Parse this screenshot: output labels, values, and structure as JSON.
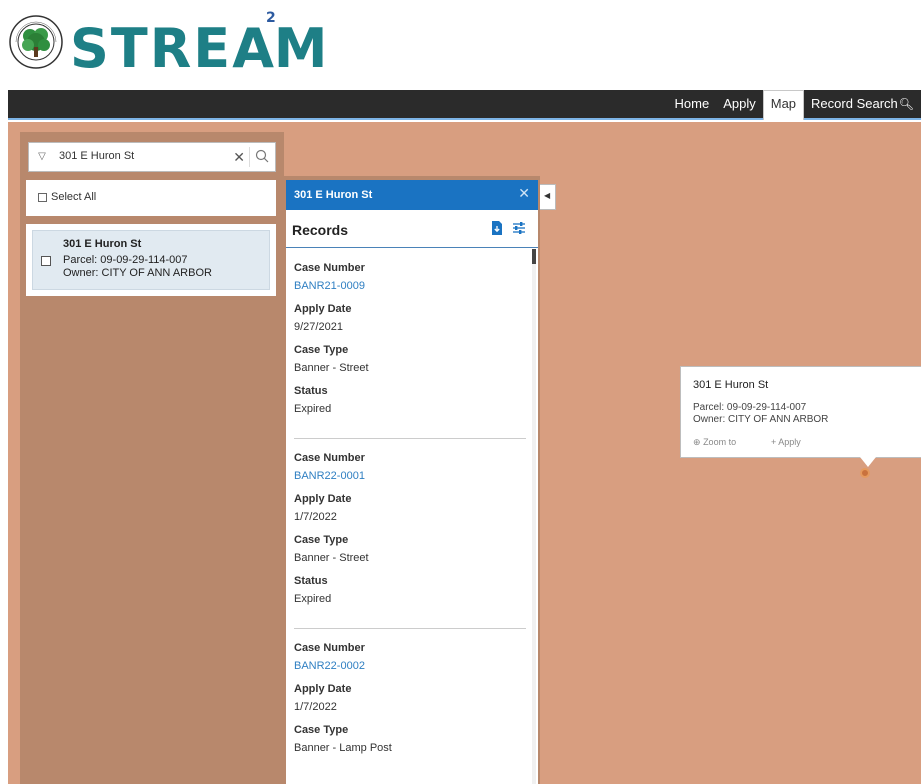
{
  "header": {
    "brand_main": "STREAM",
    "brand_pre": "STREA",
    "brand_sup": "2",
    "brand_post": "M",
    "seal_text": [
      "CITY OF ANN ARBOR",
      "MICHIGAN"
    ]
  },
  "nav": {
    "items": [
      "Home",
      "Apply",
      "Map",
      "Record Search"
    ],
    "active": "Map"
  },
  "search": {
    "value": "301 E Huron St"
  },
  "results": {
    "select_all_label": "Select All",
    "items": [
      {
        "title": "301 E Huron St",
        "parcel": "Parcel: 09-09-29-114-007",
        "owner": "Owner: CITY OF ANN ARBOR"
      }
    ]
  },
  "records_panel": {
    "header_title": "301 E Huron St",
    "sub_title": "Records",
    "labels": {
      "case_number": "Case Number",
      "apply_date": "Apply Date",
      "case_type": "Case Type",
      "status": "Status"
    },
    "records": [
      {
        "case_number": "BANR21-0009",
        "apply_date": "9/27/2021",
        "case_type": "Banner - Street",
        "status": "Expired"
      },
      {
        "case_number": "BANR22-0001",
        "apply_date": "1/7/2022",
        "case_type": "Banner - Street",
        "status": "Expired"
      },
      {
        "case_number": "BANR22-0002",
        "apply_date": "1/7/2022",
        "case_type": "Banner - Lamp Post",
        "status": ""
      }
    ]
  },
  "popup": {
    "title": "301 E Huron St",
    "parcel": "Parcel: 09-09-29-114-007",
    "owner": "Owner: CITY OF ANN ARBOR",
    "zoom_label": "Zoom to",
    "apply_label": "Apply"
  },
  "colors": {
    "brand_teal": "#1e7f86",
    "nav_bg": "#2b2b2b",
    "map_bg": "#d89e80",
    "panel_bg": "#b8886c",
    "records_header": "#1a73c2",
    "link": "#2f7fc2"
  },
  "icons": {
    "search": "search-icon",
    "clear": "close-icon",
    "dropdown": "triangle-down-icon",
    "export": "document-download-icon",
    "filter": "sliders-icon",
    "collapse": "chevron-left-icon",
    "zoom": "zoom-in-icon",
    "apply": "plus-icon",
    "marker": "location-marker-icon"
  }
}
